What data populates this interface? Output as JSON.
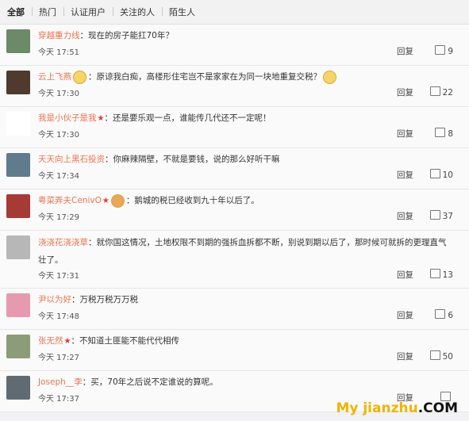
{
  "tabs": [
    "全部",
    "热门",
    "认证用户",
    "关注的人",
    "陌生人"
  ],
  "comments": [
    {
      "user": "穿越重力线",
      "text": "：现在的房子能扛70年？",
      "time": "今天 17:51",
      "reply": "回复",
      "likes": "9",
      "avatar_color": "#6b8a67",
      "badge": "",
      "emoji": "none",
      "tall": false
    },
    {
      "user": "云上飞燕",
      "text": "：原谅我白痴，高楼形住宅岂不是家家在为同一块地重复交税？",
      "time": "今天 17:30",
      "reply": "回复",
      "likes": "22",
      "avatar_color": "#4e3b2e",
      "badge": "",
      "emoji": "both",
      "tall": false
    },
    {
      "user": "我是小伙子是我",
      "text": "：还是要乐观一点，谁能传几代还不一定呢！",
      "time": "今天 17:30",
      "reply": "回复",
      "likes": "8",
      "avatar_color": "#ffffff",
      "badge": "★",
      "emoji": "none",
      "tall": false
    },
    {
      "user": "天天向上黑石投资",
      "text": "：你麻辣隔壁，不就是要钱，说的那么好听干嘛",
      "time": "今天 17:34",
      "reply": "回复",
      "likes": "10",
      "avatar_color": "#5f7b8c",
      "badge": "",
      "emoji": "none",
      "tall": false
    },
    {
      "user": "粤菜弄夫CenivO",
      "text": "：鹅城的税已经收到九十年以后了。",
      "time": "今天 17:29",
      "reply": "回复",
      "likes": "37",
      "avatar_color": "#a63a34",
      "badge": "★",
      "emoji": "prefix",
      "tall": false
    },
    {
      "user": "浇浇花浇浇草",
      "text": "：就你国这情况，土地权限不到期的强拆血拆都不断，别说到期以后了，那时候可就拆的更理直气壮了。",
      "time": "今天 17:31",
      "reply": "回复",
      "likes": "13",
      "avatar_color": "#b7b7b7",
      "badge": "",
      "emoji": "none",
      "tall": true
    },
    {
      "user": "尹以为好",
      "text": "：万税万税万万税",
      "time": "今天 17:48",
      "reply": "回复",
      "likes": "6",
      "avatar_color": "#e59ab0",
      "badge": "",
      "emoji": "none",
      "tall": false
    },
    {
      "user": "张无然",
      "text": "：不知道土匪能不能代代相传",
      "time": "今天 17:27",
      "reply": "回复",
      "likes": "50",
      "avatar_color": "#8c9c78",
      "badge": "★",
      "emoji": "none",
      "tall": false
    },
    {
      "user": "Joseph__李",
      "text": "：买，70年之后说不定谁说的算呢。",
      "time": "今天 17:37",
      "reply": "回复",
      "likes": "",
      "avatar_color": "#606a73",
      "badge": "",
      "emoji": "none",
      "tall": false
    }
  ],
  "watermark": {
    "part1": "My jianzhu",
    "part2": ".COM"
  }
}
